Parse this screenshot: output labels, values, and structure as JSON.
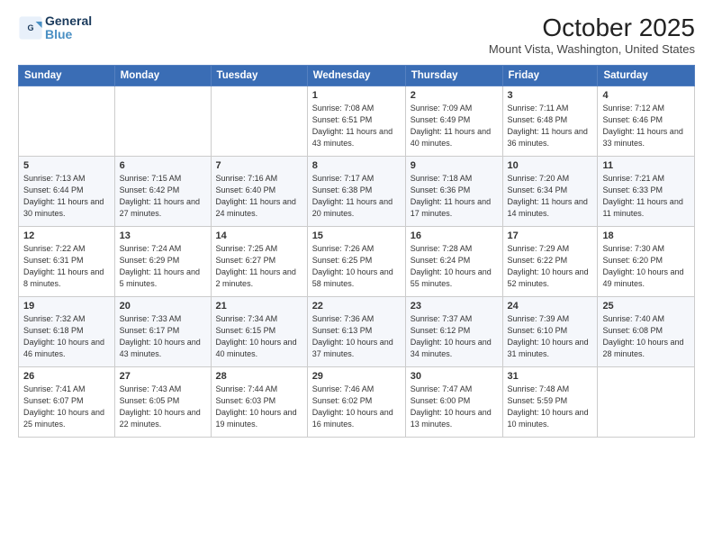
{
  "header": {
    "logo_line1": "General",
    "logo_line2": "Blue",
    "month": "October 2025",
    "location": "Mount Vista, Washington, United States"
  },
  "weekdays": [
    "Sunday",
    "Monday",
    "Tuesday",
    "Wednesday",
    "Thursday",
    "Friday",
    "Saturday"
  ],
  "weeks": [
    [
      {
        "day": "",
        "sunrise": "",
        "sunset": "",
        "daylight": ""
      },
      {
        "day": "",
        "sunrise": "",
        "sunset": "",
        "daylight": ""
      },
      {
        "day": "",
        "sunrise": "",
        "sunset": "",
        "daylight": ""
      },
      {
        "day": "1",
        "sunrise": "Sunrise: 7:08 AM",
        "sunset": "Sunset: 6:51 PM",
        "daylight": "Daylight: 11 hours and 43 minutes."
      },
      {
        "day": "2",
        "sunrise": "Sunrise: 7:09 AM",
        "sunset": "Sunset: 6:49 PM",
        "daylight": "Daylight: 11 hours and 40 minutes."
      },
      {
        "day": "3",
        "sunrise": "Sunrise: 7:11 AM",
        "sunset": "Sunset: 6:48 PM",
        "daylight": "Daylight: 11 hours and 36 minutes."
      },
      {
        "day": "4",
        "sunrise": "Sunrise: 7:12 AM",
        "sunset": "Sunset: 6:46 PM",
        "daylight": "Daylight: 11 hours and 33 minutes."
      }
    ],
    [
      {
        "day": "5",
        "sunrise": "Sunrise: 7:13 AM",
        "sunset": "Sunset: 6:44 PM",
        "daylight": "Daylight: 11 hours and 30 minutes."
      },
      {
        "day": "6",
        "sunrise": "Sunrise: 7:15 AM",
        "sunset": "Sunset: 6:42 PM",
        "daylight": "Daylight: 11 hours and 27 minutes."
      },
      {
        "day": "7",
        "sunrise": "Sunrise: 7:16 AM",
        "sunset": "Sunset: 6:40 PM",
        "daylight": "Daylight: 11 hours and 24 minutes."
      },
      {
        "day": "8",
        "sunrise": "Sunrise: 7:17 AM",
        "sunset": "Sunset: 6:38 PM",
        "daylight": "Daylight: 11 hours and 20 minutes."
      },
      {
        "day": "9",
        "sunrise": "Sunrise: 7:18 AM",
        "sunset": "Sunset: 6:36 PM",
        "daylight": "Daylight: 11 hours and 17 minutes."
      },
      {
        "day": "10",
        "sunrise": "Sunrise: 7:20 AM",
        "sunset": "Sunset: 6:34 PM",
        "daylight": "Daylight: 11 hours and 14 minutes."
      },
      {
        "day": "11",
        "sunrise": "Sunrise: 7:21 AM",
        "sunset": "Sunset: 6:33 PM",
        "daylight": "Daylight: 11 hours and 11 minutes."
      }
    ],
    [
      {
        "day": "12",
        "sunrise": "Sunrise: 7:22 AM",
        "sunset": "Sunset: 6:31 PM",
        "daylight": "Daylight: 11 hours and 8 minutes."
      },
      {
        "day": "13",
        "sunrise": "Sunrise: 7:24 AM",
        "sunset": "Sunset: 6:29 PM",
        "daylight": "Daylight: 11 hours and 5 minutes."
      },
      {
        "day": "14",
        "sunrise": "Sunrise: 7:25 AM",
        "sunset": "Sunset: 6:27 PM",
        "daylight": "Daylight: 11 hours and 2 minutes."
      },
      {
        "day": "15",
        "sunrise": "Sunrise: 7:26 AM",
        "sunset": "Sunset: 6:25 PM",
        "daylight": "Daylight: 10 hours and 58 minutes."
      },
      {
        "day": "16",
        "sunrise": "Sunrise: 7:28 AM",
        "sunset": "Sunset: 6:24 PM",
        "daylight": "Daylight: 10 hours and 55 minutes."
      },
      {
        "day": "17",
        "sunrise": "Sunrise: 7:29 AM",
        "sunset": "Sunset: 6:22 PM",
        "daylight": "Daylight: 10 hours and 52 minutes."
      },
      {
        "day": "18",
        "sunrise": "Sunrise: 7:30 AM",
        "sunset": "Sunset: 6:20 PM",
        "daylight": "Daylight: 10 hours and 49 minutes."
      }
    ],
    [
      {
        "day": "19",
        "sunrise": "Sunrise: 7:32 AM",
        "sunset": "Sunset: 6:18 PM",
        "daylight": "Daylight: 10 hours and 46 minutes."
      },
      {
        "day": "20",
        "sunrise": "Sunrise: 7:33 AM",
        "sunset": "Sunset: 6:17 PM",
        "daylight": "Daylight: 10 hours and 43 minutes."
      },
      {
        "day": "21",
        "sunrise": "Sunrise: 7:34 AM",
        "sunset": "Sunset: 6:15 PM",
        "daylight": "Daylight: 10 hours and 40 minutes."
      },
      {
        "day": "22",
        "sunrise": "Sunrise: 7:36 AM",
        "sunset": "Sunset: 6:13 PM",
        "daylight": "Daylight: 10 hours and 37 minutes."
      },
      {
        "day": "23",
        "sunrise": "Sunrise: 7:37 AM",
        "sunset": "Sunset: 6:12 PM",
        "daylight": "Daylight: 10 hours and 34 minutes."
      },
      {
        "day": "24",
        "sunrise": "Sunrise: 7:39 AM",
        "sunset": "Sunset: 6:10 PM",
        "daylight": "Daylight: 10 hours and 31 minutes."
      },
      {
        "day": "25",
        "sunrise": "Sunrise: 7:40 AM",
        "sunset": "Sunset: 6:08 PM",
        "daylight": "Daylight: 10 hours and 28 minutes."
      }
    ],
    [
      {
        "day": "26",
        "sunrise": "Sunrise: 7:41 AM",
        "sunset": "Sunset: 6:07 PM",
        "daylight": "Daylight: 10 hours and 25 minutes."
      },
      {
        "day": "27",
        "sunrise": "Sunrise: 7:43 AM",
        "sunset": "Sunset: 6:05 PM",
        "daylight": "Daylight: 10 hours and 22 minutes."
      },
      {
        "day": "28",
        "sunrise": "Sunrise: 7:44 AM",
        "sunset": "Sunset: 6:03 PM",
        "daylight": "Daylight: 10 hours and 19 minutes."
      },
      {
        "day": "29",
        "sunrise": "Sunrise: 7:46 AM",
        "sunset": "Sunset: 6:02 PM",
        "daylight": "Daylight: 10 hours and 16 minutes."
      },
      {
        "day": "30",
        "sunrise": "Sunrise: 7:47 AM",
        "sunset": "Sunset: 6:00 PM",
        "daylight": "Daylight: 10 hours and 13 minutes."
      },
      {
        "day": "31",
        "sunrise": "Sunrise: 7:48 AM",
        "sunset": "Sunset: 5:59 PM",
        "daylight": "Daylight: 10 hours and 10 minutes."
      },
      {
        "day": "",
        "sunrise": "",
        "sunset": "",
        "daylight": ""
      }
    ]
  ]
}
